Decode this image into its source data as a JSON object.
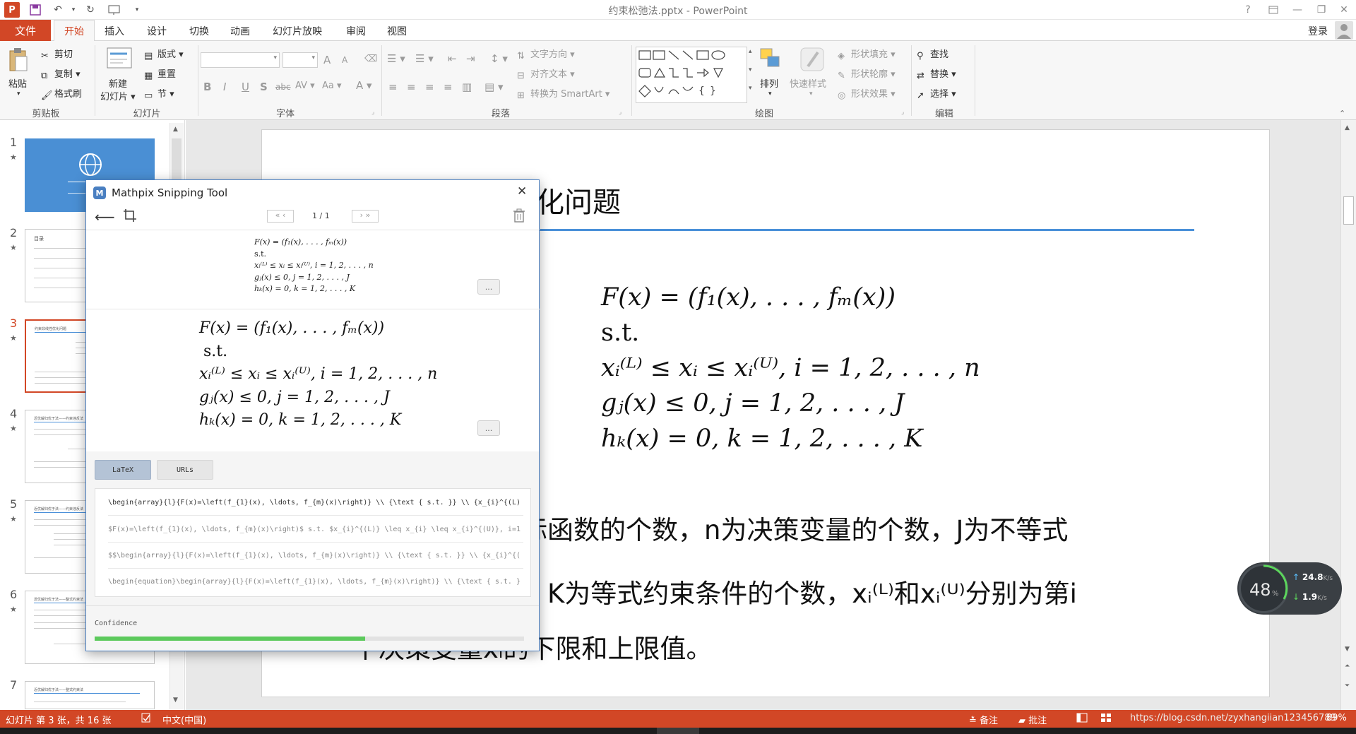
{
  "window": {
    "title": "约束松弛法.pptx - PowerPoint"
  },
  "quick_access": {
    "user": "登录"
  },
  "tabs": [
    "文件",
    "开始",
    "插入",
    "设计",
    "切换",
    "动画",
    "幻灯片放映",
    "审阅",
    "视图"
  ],
  "ribbon": {
    "clipboard": {
      "paste": "粘贴",
      "cut": "剪切",
      "copy": "复制",
      "format_painter": "格式刷",
      "label": "剪贴板"
    },
    "slides": {
      "new_slide": "新建",
      "new_slide2": "幻灯片",
      "layout": "版式",
      "reset": "重置",
      "section": "节",
      "label": "幻灯片"
    },
    "font": {
      "label": "字体",
      "bold": "B",
      "italic": "I",
      "underline": "U",
      "strike": "S",
      "abc": "abc",
      "av": "AV",
      "aa": "Aa",
      "grow": "A",
      "shrink": "A",
      "color": "A"
    },
    "paragraph": {
      "text_direction": "文字方向",
      "align_text": "对齐文本",
      "smartart": "转换为 SmartArt",
      "label": "段落"
    },
    "drawing": {
      "arrange": "排列",
      "quick_styles": "快速样式",
      "shape_fill": "形状填充",
      "shape_outline": "形状轮廓",
      "shape_effects": "形状效果",
      "label": "绘图"
    },
    "editing": {
      "find": "查找",
      "replace": "替换",
      "select": "选择",
      "label": "编辑"
    }
  },
  "thumbnails": {
    "numbers": [
      "1",
      "2",
      "3",
      "4",
      "5",
      "6",
      "7"
    ],
    "star": "★",
    "t2_title": "目录",
    "t3_title": "约束非线性优化问题",
    "t4_title": "近优解归优于法——约束违反法",
    "t5_title": "近优解归优于法——约束违反法",
    "t6_title": "近优解归优于法——整式约束法",
    "t7_title": "近优解归优于法——整式约束法"
  },
  "slide": {
    "title_visible": "化问题",
    "formula": {
      "line1": "F(x) = (f₁(x), . . . , fₘ(x))",
      "line2": "s.t.",
      "line3": "xᵢ⁽ᴸ⁾ ≤ xᵢ ≤ xᵢ⁽ᵁ⁾, i = 1, 2, . . . , n",
      "line4": "gⱼ(x) ≤ 0, j = 1, 2, . . . , J",
      "line5": "hₖ(x) = 0, k = 1, 2, . . . , K"
    },
    "body1": "目标函数的个数，n为决策变量的个数，J为不等式",
    "body2": "数，K为等式约束条件的个数，xᵢ⁽ᴸ⁾和xᵢ⁽ᵁ⁾分别为第i",
    "body3": "个决策变量xᵢ的下限和上限值。"
  },
  "mathpix": {
    "title": "Mathpix Snipping Tool",
    "page": "1 / 1",
    "tab_latex": "LaTeX",
    "tab_urls": "URLs",
    "more": "...",
    "latex_rows": [
      "\\begin{array}{l}{F(x)=\\left(f_{1}(x), \\ldots, f_{m}(x)\\right)} \\\\ {\\text { s.t. }} \\\\ {x_{i}^{(L)",
      "$F(x)=\\left(f_{1}(x), \\ldots, f_{m}(x)\\right)$ s.t. $x_{i}^{(L)} \\leq x_{i} \\leq x_{i}^{(U)}, i=1",
      "$$\\begin{array}{l}{F(x)=\\left(f_{1}(x), \\ldots, f_{m}(x)\\right)} \\\\ {\\text { s.t. }} \\\\ {x_{i}^{(",
      "\\begin{equation}\\begin{array}{l}{F(x)=\\left(f_{1}(x), \\ldots, f_{m}(x)\\right)} \\\\ {\\text { s.t. }"
    ],
    "confidence_label": "Confidence",
    "confidence": 0.63
  },
  "status": {
    "slide_info": "幻灯片 第 3 张，共 16 张",
    "language": "中文(中国)",
    "notes": "备注",
    "comments": "批注",
    "zoom": "89%",
    "watermark": "https://blog.csdn.net/zyxhangiian123456789"
  },
  "speed_widget": {
    "percent": "48",
    "unit": "%",
    "up": "24.8",
    "down": "1.9",
    "rate_unit": "K/s"
  },
  "colors": {
    "accent": "#d24726",
    "mathpix_blue": "#4a7fc1",
    "confidence_green": "#5cc95c",
    "slide_title_line": "#4a90d9"
  }
}
